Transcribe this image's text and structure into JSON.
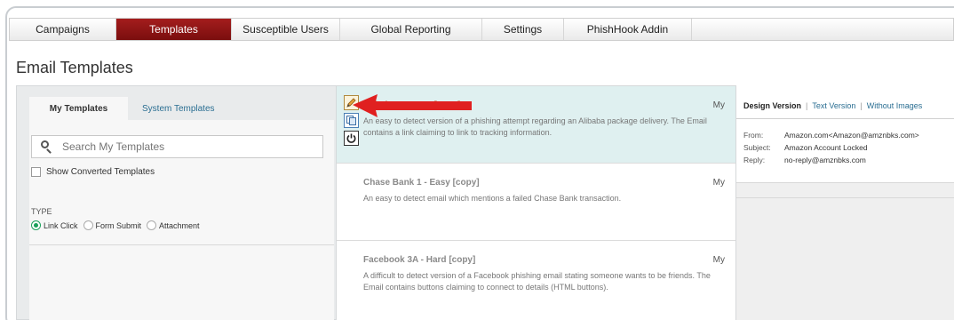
{
  "nav": {
    "tabs": [
      {
        "label": "Campaigns",
        "active": false
      },
      {
        "label": "Templates",
        "active": true
      },
      {
        "label": "Susceptible Users",
        "active": false
      },
      {
        "label": "Global Reporting",
        "active": false
      },
      {
        "label": "Settings",
        "active": false
      },
      {
        "label": "PhishHook Addin",
        "active": false
      }
    ]
  },
  "page": {
    "title": "Email Templates"
  },
  "filters": {
    "tabs": {
      "my": "My Templates",
      "system": "System Templates"
    },
    "search_placeholder": "Search My Templates",
    "show_converted": "Show Converted Templates",
    "type_label": "TYPE",
    "types": [
      "Link Click",
      "Form Submit",
      "Attachment"
    ],
    "selected_type": "Link Click"
  },
  "templates": [
    {
      "title": "Alibaba 1 - Easy [copy]",
      "owner": "My",
      "description": "An easy to detect version of a phishing attempt regarding an Alibaba package delivery. The Email contains a link claiming to link to tracking information.",
      "selected": true
    },
    {
      "title": "Chase Bank 1 - Easy [copy]",
      "owner": "My",
      "description": "An easy to detect email which mentions a failed Chase Bank transaction.",
      "selected": false
    },
    {
      "title": "Facebook 3A - Hard [copy]",
      "owner": "My",
      "description": "A difficult to detect version of a Facebook phishing email stating someone wants to be friends. The Email contains buttons claiming to connect to details (HTML buttons).",
      "selected": false
    }
  ],
  "preview": {
    "tabs": {
      "design": "Design Version",
      "text": "Text Version",
      "without_images": "Without Images"
    },
    "from_label": "From:",
    "from": "Amazon.com<Amazon@amznbks.com>",
    "subject_label": "Subject:",
    "subject": "Amazon Account Locked",
    "reply_label": "Reply:",
    "reply": "no-reply@amznbks.com"
  },
  "colors": {
    "active_tab": "#8b1414",
    "link": "#2a6e92",
    "selected_row": "#dff0f0",
    "radio_on": "#1aa05a",
    "arrow": "#e02020"
  }
}
